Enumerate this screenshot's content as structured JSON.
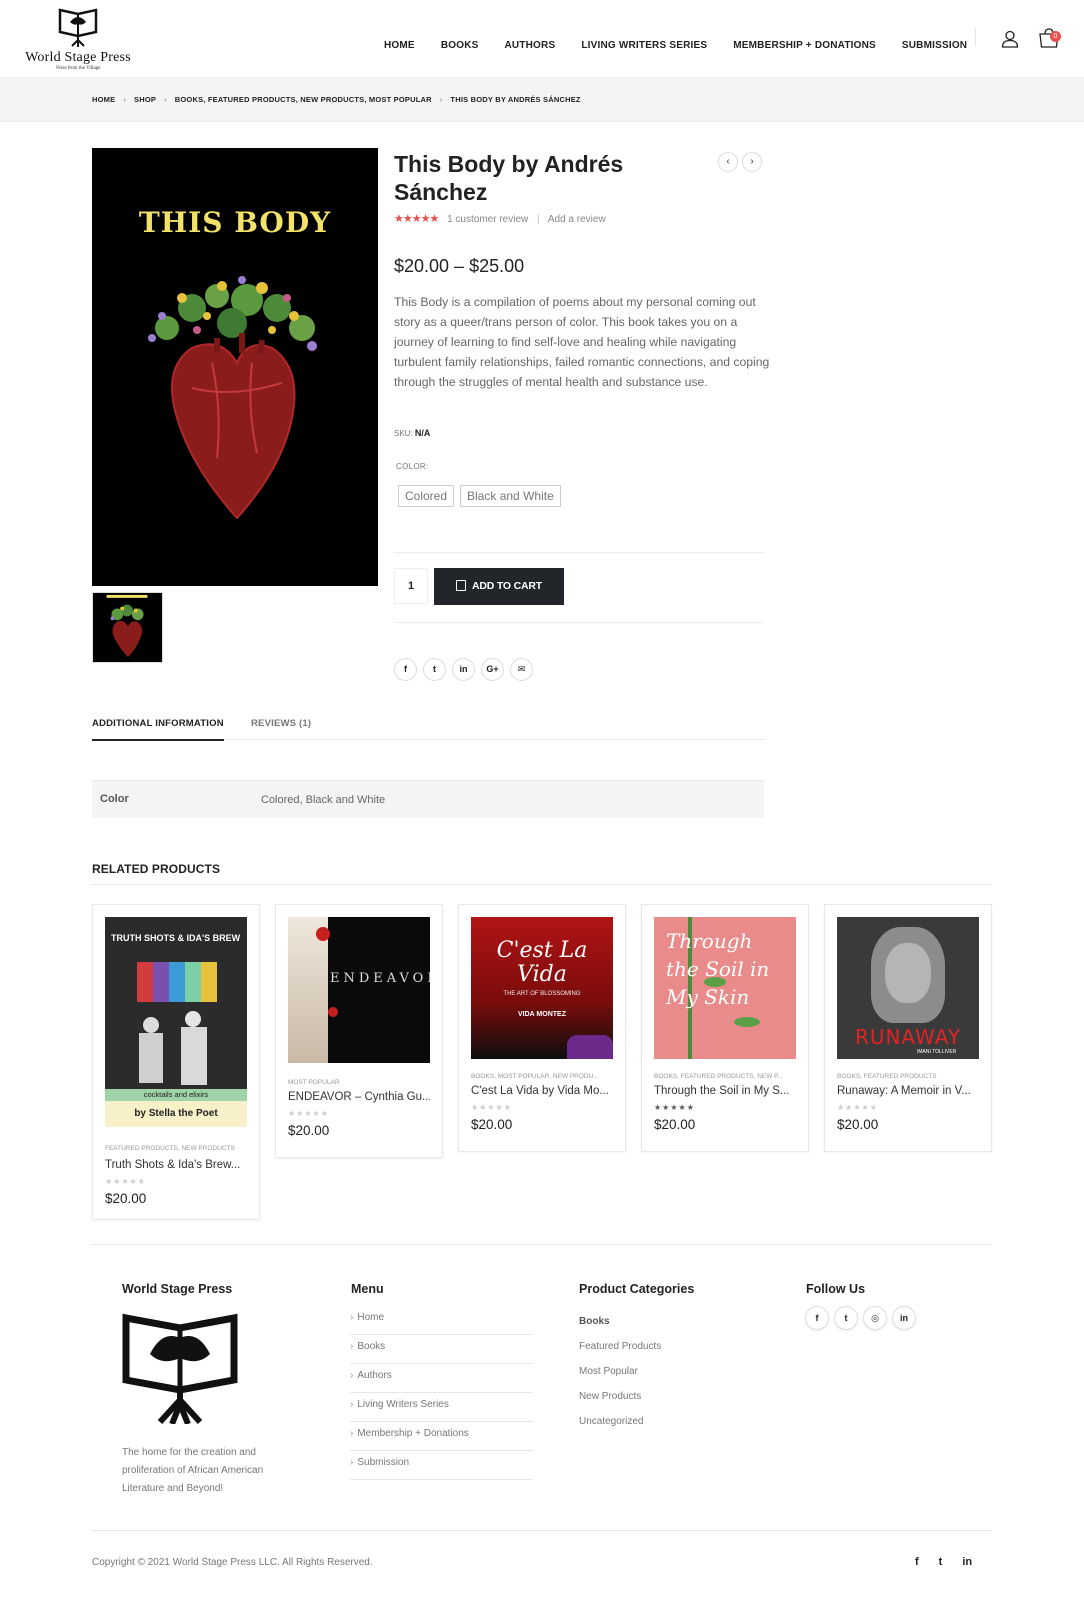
{
  "header": {
    "logo_name": "World Stage Press",
    "logo_tagline": "Verse from the Village",
    "nav": [
      "HOME",
      "BOOKS",
      "AUTHORS",
      "LIVING WRITERS SERIES",
      "MEMBERSHIP + DONATIONS",
      "SUBMISSION"
    ],
    "cart_count": "0"
  },
  "breadcrumb": {
    "home": "HOME",
    "shop": "SHOP",
    "categories": "BOOKS,  FEATURED PRODUCTS,  NEW PRODUCTS,  MOST POPULAR",
    "current": "THIS BODY BY ANDRÉS SÁNCHEZ",
    "separator": "›"
  },
  "product": {
    "cover_title": "THIS BODY",
    "title": "This Body by Andrés Sánchez",
    "stars": "★★★★★",
    "review_count": "1 customer review",
    "add_review": "Add a review",
    "price": "$20.00 – $25.00",
    "description": "This Body is a compilation of poems about my personal coming out story as a queer/trans person of color. This book takes you on a journey of learning to find self-love and healing while navigating turbulent family relationships, failed romantic connections, and coping through the struggles of mental health and substance use.",
    "sku_label": "SKU:",
    "sku_value": "N/A",
    "color_label": "COLOR:",
    "color_options": [
      "Colored",
      "Black and White"
    ],
    "quantity": "1",
    "add_to_cart": "ADD TO CART",
    "prev_icon": "‹",
    "next_icon": "›"
  },
  "share": [
    "f",
    "t",
    "in",
    "G+",
    "✉"
  ],
  "tabs": {
    "additional": "ADDITIONAL INFORMATION",
    "reviews": "REVIEWS (1)"
  },
  "attributes": {
    "label": "Color",
    "value": "Colored, Black and White"
  },
  "related": {
    "title": "RELATED PRODUCTS",
    "items": [
      {
        "cats": "FEATURED PRODUCTS, NEW PRODUCTS",
        "name": "Truth Shots & Ida's Brew...",
        "stars": "★★★★★",
        "price": "$20.00",
        "cover_top": "TRUTH SHOTS & IDA'S BREW",
        "cover_sub": "cocktails and elixirs",
        "cover_author": "by Stella the Poet"
      },
      {
        "cats": "MOST POPULAR",
        "name": "ENDEAVOR – Cynthia Gu...",
        "stars": "★★★★★",
        "price": "$20.00",
        "cover_top": "ENDEAVOR"
      },
      {
        "cats": "BOOKS, MOST POPULAR, NEW PRODU...",
        "name": "C'est La Vida by Vida Mo...",
        "stars": "★★★★★",
        "price": "$20.00",
        "cover_top": "C'est La Vida",
        "cover_sub": "THE ART OF BLOSSOMING",
        "cover_author": "VIDA MONTEZ"
      },
      {
        "cats": "BOOKS, FEATURED PRODUCTS, NEW P...",
        "name": "Through the Soil in My S...",
        "stars": "★★★★★",
        "price": "$20.00",
        "cover_top": "Through the Soil in My Skin"
      },
      {
        "cats": "BOOKS, FEATURED PRODUCTS",
        "name": "Runaway: A Memoir in V...",
        "stars": "★★★★★",
        "price": "$20.00",
        "cover_top": "RUNAWAY",
        "cover_author": "IMANI TOLLIVER"
      }
    ]
  },
  "footer": {
    "about_title": "World Stage Press",
    "about_text": "The home for the creation and proliferation of African American Literature and Beyond!",
    "menu_title": "Menu",
    "menu": [
      "Home",
      "Books",
      "Authors",
      "Living Writers Series",
      "Membership + Donations",
      "Submission"
    ],
    "cats_title": "Product Categories",
    "cats": [
      "Books",
      "Featured Products",
      "Most Popular",
      "New Products",
      "Uncategorized"
    ],
    "follow_title": "Follow Us",
    "follow": [
      "f",
      "t",
      "◎",
      "in"
    ],
    "copyright": "Copyright © 2021 World Stage Press LLC. All Rights Reserved.",
    "bottom_social": [
      "f",
      "t",
      "in"
    ]
  },
  "colors": {
    "accent_red": "#e94f4f",
    "dark_button": "#222529",
    "cover_yellow": "#f2e26a"
  }
}
